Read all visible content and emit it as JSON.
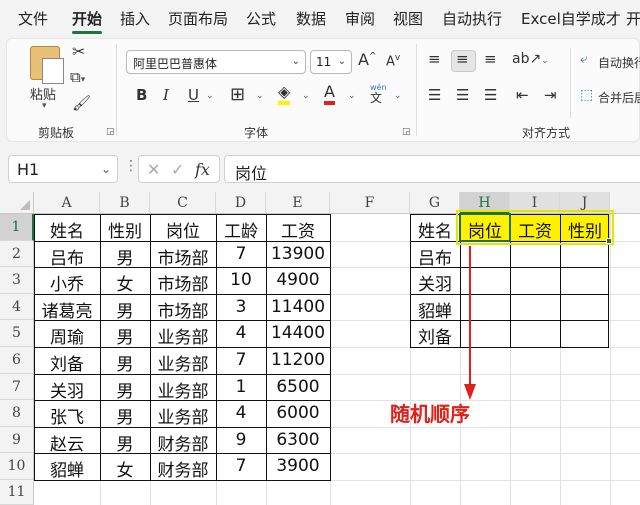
{
  "ribbon_tabs": [
    "文件",
    "开始",
    "插入",
    "页面布局",
    "公式",
    "数据",
    "审阅",
    "视图",
    "自动执行",
    "Excel自学成才",
    "开"
  ],
  "active_tab": "开始",
  "clipboard": {
    "paste_label": "粘贴",
    "group_label": "剪贴板"
  },
  "font": {
    "name": "阿里巴巴普惠体",
    "size": "11",
    "group_label": "字体",
    "grow": "A",
    "shrink": "A",
    "bold": "B",
    "italic": "I",
    "underline": "U",
    "phonetic_top": "wén",
    "phonetic_bottom": "文"
  },
  "alignment": {
    "group_label": "对齐方式",
    "wrap_label": "自动换行",
    "merge_label": "合并后居"
  },
  "formula_bar": {
    "name_box": "H1",
    "fx": "fx",
    "content": "岗位"
  },
  "columns": [
    "A",
    "B",
    "C",
    "D",
    "E",
    "F",
    "G",
    "H",
    "I",
    "J"
  ],
  "rows": [
    "1",
    "2",
    "3",
    "4",
    "5",
    "6",
    "7",
    "8",
    "9",
    "10",
    "11"
  ],
  "selected_column": "H",
  "selected_row": "1",
  "table1": {
    "headers": [
      "姓名",
      "性别",
      "岗位",
      "工龄",
      "工资"
    ],
    "rows": [
      [
        "吕布",
        "男",
        "市场部",
        "7",
        "13900"
      ],
      [
        "小乔",
        "女",
        "市场部",
        "10",
        "4900"
      ],
      [
        "诸葛亮",
        "男",
        "市场部",
        "3",
        "11400"
      ],
      [
        "周瑜",
        "男",
        "业务部",
        "4",
        "14400"
      ],
      [
        "刘备",
        "男",
        "业务部",
        "7",
        "11200"
      ],
      [
        "关羽",
        "男",
        "业务部",
        "1",
        "6500"
      ],
      [
        "张飞",
        "男",
        "业务部",
        "4",
        "6000"
      ],
      [
        "赵云",
        "男",
        "财务部",
        "9",
        "6300"
      ],
      [
        "貂蝉",
        "女",
        "财务部",
        "7",
        "3900"
      ]
    ]
  },
  "table2": {
    "headers": [
      "姓名",
      "岗位",
      "工资",
      "性别"
    ],
    "names": [
      "吕布",
      "关羽",
      "貂蝉",
      "刘备"
    ]
  },
  "annotation": "随机顺序",
  "colors": {
    "accent": "#1e7145",
    "highlight": "#fff200",
    "annotation": "#e0211a"
  }
}
